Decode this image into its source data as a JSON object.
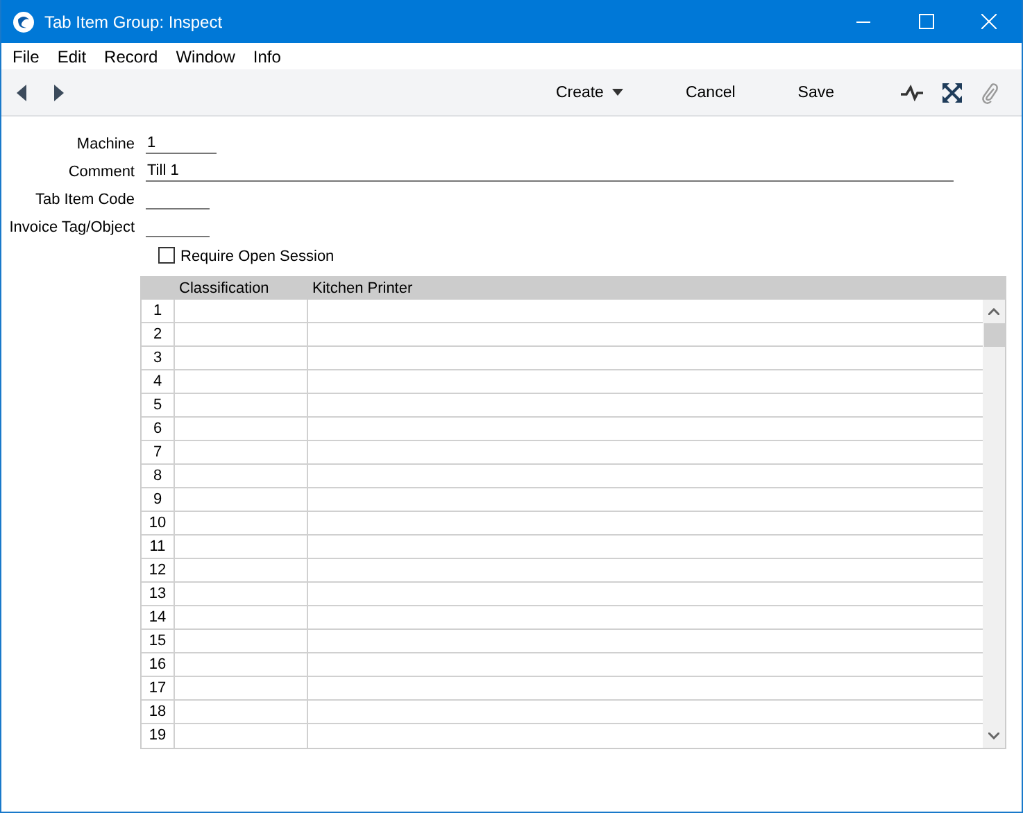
{
  "window": {
    "title": "Tab Item Group: Inspect"
  },
  "menu": [
    "File",
    "Edit",
    "Record",
    "Window",
    "Info"
  ],
  "toolbar": {
    "buttons": [
      {
        "label": "Create",
        "kind": "dropdown"
      },
      {
        "label": "Cancel",
        "kind": "plain"
      },
      {
        "label": "Save",
        "kind": "plain"
      }
    ]
  },
  "form": {
    "fields": [
      {
        "label": "Machine",
        "value": "1"
      },
      {
        "label": "Comment",
        "value": "Till 1"
      },
      {
        "label": "Tab Item Code"
      },
      {
        "label": "Invoice Tag/Object"
      }
    ],
    "checkbox": {
      "label": "Require Open Session",
      "checked": false
    }
  },
  "table": {
    "columns": [
      "Classification",
      "Kitchen Printer"
    ],
    "rows": [
      "1",
      "2",
      "3",
      "4",
      "5",
      "6",
      "7",
      "8",
      "9",
      "10",
      "11",
      "12",
      "13",
      "14",
      "15",
      "16",
      "17",
      "18",
      "19"
    ]
  }
}
